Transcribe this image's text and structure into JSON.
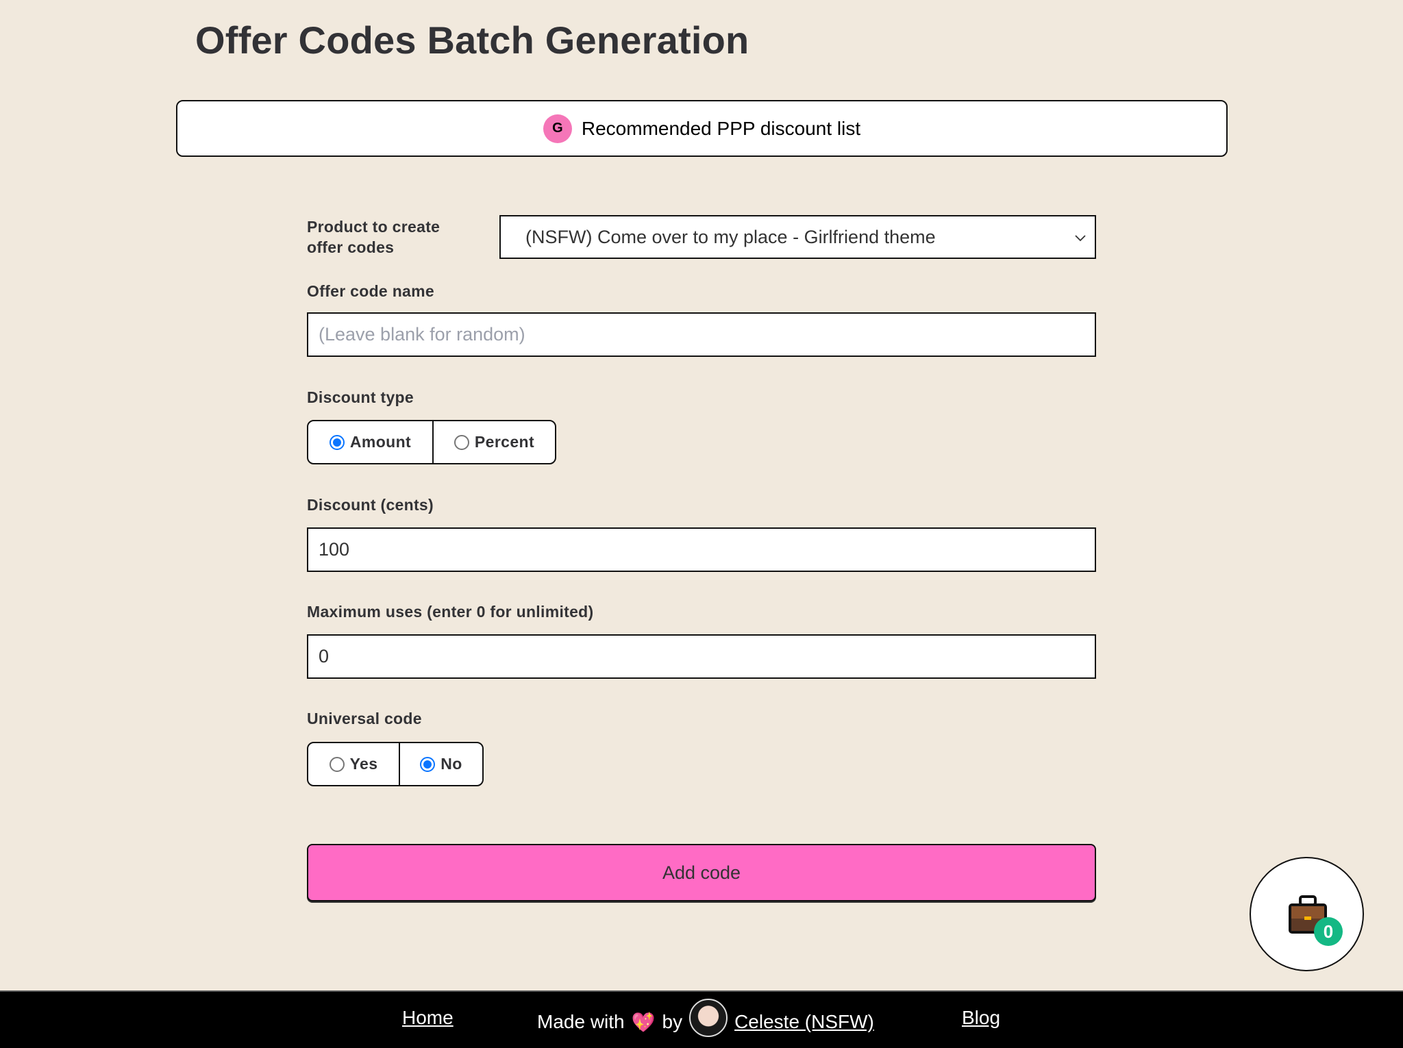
{
  "page": {
    "title": "Offer Codes Batch Generation"
  },
  "ppp_banner": {
    "badge_letter": "G",
    "label": "Recommended PPP discount list",
    "badge_color": "#f576b8"
  },
  "form": {
    "product": {
      "label": "Product to create offer codes",
      "selected": "(NSFW) Come over to my place - Girlfriend theme"
    },
    "offer_code_name": {
      "label": "Offer code name",
      "value": "",
      "placeholder": "(Leave blank for random)"
    },
    "discount_type": {
      "label": "Discount type",
      "options": [
        {
          "label": "Amount",
          "selected": true
        },
        {
          "label": "Percent",
          "selected": false
        }
      ]
    },
    "discount": {
      "label": "Discount (cents)",
      "value": "100"
    },
    "max_uses": {
      "label": "Maximum uses (enter 0 for unlimited)",
      "value": "0"
    },
    "universal_code": {
      "label": "Universal code",
      "options": [
        {
          "label": "Yes",
          "selected": false
        },
        {
          "label": "No",
          "selected": true
        }
      ]
    },
    "submit_label": "Add code",
    "submit_color": "#ff6bc5"
  },
  "cart": {
    "icon": "briefcase-icon",
    "count": "0",
    "badge_color": "#14b884"
  },
  "footer": {
    "home_label": "Home",
    "made_with": "Made with",
    "heart_icon": "sparkling-heart-icon",
    "by": "by",
    "author": "Celeste (NSFW)",
    "blog_label": "Blog"
  }
}
